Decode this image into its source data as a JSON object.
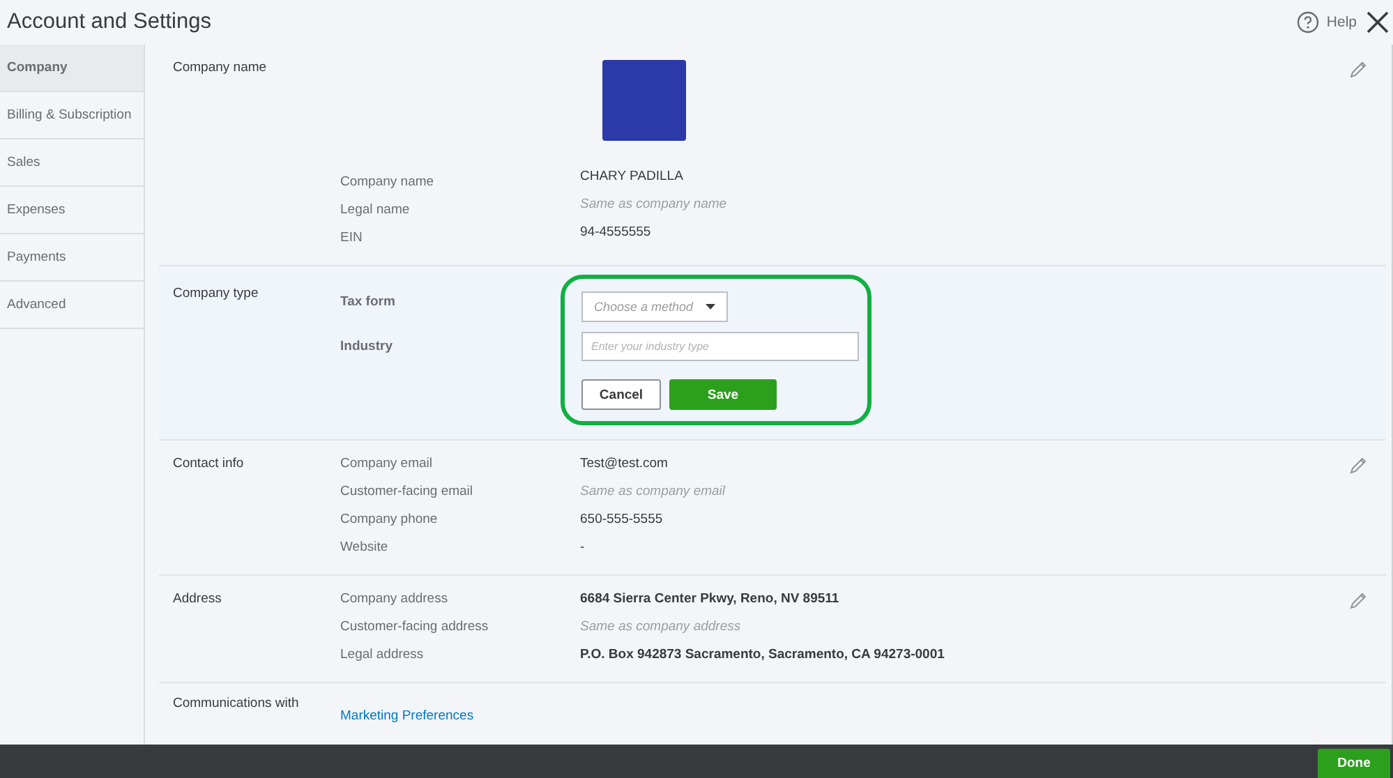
{
  "window": {
    "title": "Account and Settings",
    "help_label": "Help"
  },
  "sidebar": {
    "items": [
      {
        "label": "Company",
        "selected": true
      },
      {
        "label": "Billing & Subscription",
        "selected": false
      },
      {
        "label": "Sales",
        "selected": false
      },
      {
        "label": "Expenses",
        "selected": false
      },
      {
        "label": "Payments",
        "selected": false
      },
      {
        "label": "Advanced",
        "selected": false
      }
    ]
  },
  "sections": [
    {
      "kind": "fields",
      "title": "Company name",
      "logo": true,
      "fields": [
        {
          "kind": "value",
          "label": "Company name",
          "value": "CHARY PADILLA"
        },
        {
          "kind": "default",
          "label": "Legal name",
          "placeholder": "Same as company name"
        },
        {
          "kind": "value",
          "label": "EIN",
          "value": "94-4555555"
        }
      ]
    },
    {
      "kind": "form",
      "title": "Company type",
      "highlighted": true,
      "tax_form": {
        "label": "Tax form",
        "placeholder": "Choose a method"
      },
      "industry": {
        "label": "Industry",
        "placeholder": "Enter your industry type"
      },
      "cancel": "Cancel",
      "save": "Save"
    },
    {
      "kind": "fields",
      "title": "Contact info",
      "logo": false,
      "fields": [
        {
          "kind": "value",
          "label": "Company email",
          "value": "Test@test.com"
        },
        {
          "kind": "default",
          "label": "Customer-facing email",
          "placeholder": "Same as company email"
        },
        {
          "kind": "value",
          "label": "Company phone",
          "value": "650-555-5555"
        },
        {
          "kind": "value",
          "label": "Website",
          "value": "-"
        }
      ]
    },
    {
      "kind": "fields",
      "title": "Address",
      "logo": false,
      "fields": [
        {
          "kind": "strong",
          "label": "Company address",
          "value": "6684 Sierra Center Pkwy, Reno, NV 89511"
        },
        {
          "kind": "default",
          "label": "Customer-facing address",
          "placeholder": "Same as company address"
        },
        {
          "kind": "strong",
          "label": "Legal address",
          "value": "P.O. Box 942873 Sacramento, Sacramento, CA 94273-0001"
        }
      ]
    },
    {
      "kind": "link",
      "title": "Communications with",
      "link": "Marketing Preferences"
    }
  ],
  "footer": {
    "done": "Done"
  }
}
